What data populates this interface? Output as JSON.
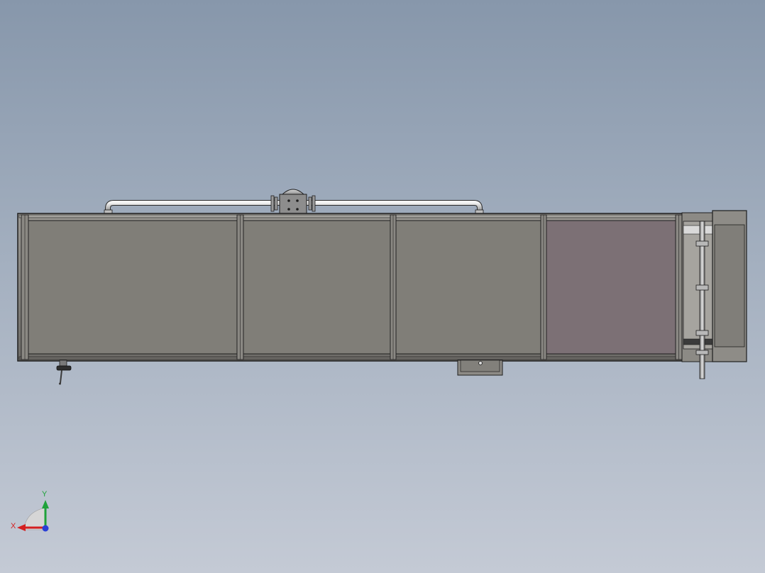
{
  "viewport": {
    "background_top": "#8797ab",
    "background_bottom": "#c4cad5"
  },
  "model": {
    "panel_colors": {
      "frame": "#7f7d78",
      "panel_gray": "#807e78",
      "panel_mauve": "#7c7075",
      "outline": "#1e1e1e",
      "pipe": "#c9c9c9"
    },
    "panel_count": 4
  },
  "triad": {
    "x_label": "X",
    "y_label": "Y",
    "x_color": "#d42020",
    "y_color": "#1fa23a",
    "z_color": "#2a3fd6"
  }
}
